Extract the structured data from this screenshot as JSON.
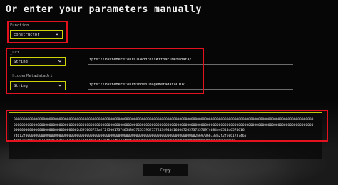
{
  "title": "Or enter your parameters manually",
  "function": {
    "label": "Function",
    "selected": "constructor"
  },
  "uri": {
    "label": "_uri",
    "type": "String",
    "value": "ipfs://PasteHereYourCIDAddressWithNFTMetadata/"
  },
  "hidden_uri": {
    "label": "_hiddenMetadataUri",
    "type": "String",
    "value": "ipfs://PasteHereYourHiddenImageMetadataCID/"
  },
  "bytecode": {
    "lines": [
      "00000000000000000000000000000000000000000000000000000000000000000000000000000000000000000000000000000000000000000000000000000000000000000000000000000000",
      "00000000000000000000000000000000000000000000000000000000000000000000000000000000000000000000000000000000000000000000000000000000000000000000000000000000",
      "000000000000000000000000000000002d697066733a2f2f506173746548657265596f757243494441646472657373576974684e46544d6574616",
      "74612f000000000000000000000000000000000000000000000000000000000000000000000000000000000000002b697066733a2f2f5061737465",
      "48657265596f75724869646465e6496d6167654d657461646174614349442f00000000000000000000000000000000000000000000000000"
    ]
  },
  "copy_label": "Copy",
  "colors": {
    "accent_border": "#cfd40a",
    "highlight_box": "#e3121e",
    "background": "#060606"
  },
  "icons": {
    "dropdown": "chevron-down-icon"
  }
}
